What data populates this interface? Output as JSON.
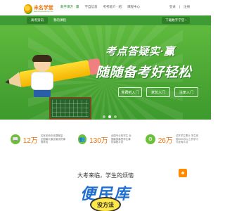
{
  "header": {
    "logo_title": "未名学堂",
    "logo_sub": "weimingxuetang.com",
    "nav": [
      {
        "label": "数字课方 · 赢",
        "active": true
      },
      {
        "label": "学自信息"
      },
      {
        "label": "考考班介 · 绍"
      },
      {
        "label": "课程中心"
      }
    ],
    "right": [
      "登录",
      "注册"
    ]
  },
  "subnav": {
    "tab1": "高考资讯",
    "tab2": "我的课程",
    "right": "下载数字学堂 ›"
  },
  "hero": {
    "slogan1": "考点答疑实·赢",
    "slogan2": "随随备考好轻松",
    "buttons": [
      "免费听入门",
      "家长入门",
      "注册入门"
    ],
    "dot_count": 3,
    "active_dot": 1
  },
  "stats": [
    {
      "icon": "📖",
      "num": "12万",
      "desc": "名家老师在线课程量 全国最大最全最优质课程体验"
    },
    {
      "icon": "👥",
      "num": "130万",
      "desc": "全国专业的学生 全国最美最受学生喜欢课程平台"
    },
    {
      "icon": "⚙",
      "num": "26万",
      "desc": "试学学生累计 学生体验5000次以上的学习与咨询平台"
    }
  ],
  "section": {
    "title": "大考来临，学生的烦恼",
    "icon": "♣",
    "watermark": "便民库",
    "bubble": "没方法"
  },
  "colors": {
    "brand_green": "#3f9c35",
    "accent_orange": "#e8730c"
  }
}
